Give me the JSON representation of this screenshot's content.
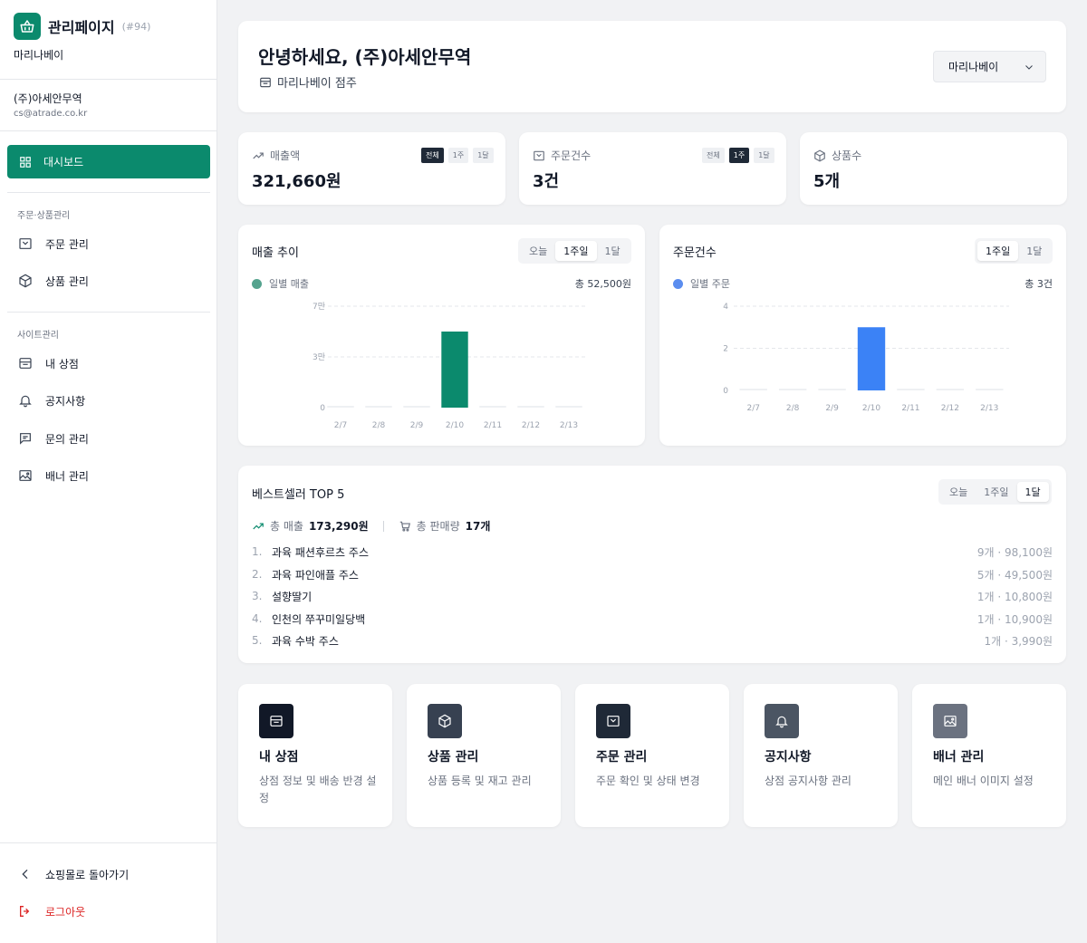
{
  "sidebar": {
    "brand_title": "관리페이지",
    "brand_id": "(#94)",
    "brand_sub": "마리나베이",
    "account_name": "(주)아세안무역",
    "account_email": "cs@atrade.co.kr",
    "dashboard_label": "대시보드",
    "section1": "주문·상품관리",
    "order_label": "주문 관리",
    "product_label": "상품 관리",
    "section2": "사이트관리",
    "store_label": "내 상점",
    "notice_label": "공지사항",
    "inquiry_label": "문의 관리",
    "banner_label": "배너 관리",
    "back_label": "쇼핑몰로 돌아가기",
    "logout_label": "로그아웃"
  },
  "header": {
    "greeting": "안녕하세요, (주)아세안무역",
    "store_owner": "마리나베이 점주",
    "store_select": "마리나베이"
  },
  "stats": {
    "sales": {
      "label": "매출액",
      "value": "321,660원",
      "periods": [
        "전체",
        "1주",
        "1달"
      ],
      "active": 0
    },
    "orders": {
      "label": "주문건수",
      "value": "3건",
      "periods": [
        "전체",
        "1주",
        "1달"
      ],
      "active": 1
    },
    "products": {
      "label": "상품수",
      "value": "5개"
    }
  },
  "sales_chart": {
    "title": "매출 추이",
    "tabs": [
      "오늘",
      "1주일",
      "1달"
    ],
    "active_tab": 1,
    "legend": "일별 매출",
    "total": "총 52,500원"
  },
  "orders_chart": {
    "title": "주문건수",
    "tabs": [
      "1주일",
      "1달"
    ],
    "active_tab": 0,
    "legend": "일별 주문",
    "total": "총 3건"
  },
  "chart_data": [
    {
      "type": "bar",
      "title": "매출 추이",
      "categories": [
        "2/7",
        "2/8",
        "2/9",
        "2/10",
        "2/11",
        "2/12",
        "2/13"
      ],
      "series": [
        {
          "name": "일별 매출",
          "values": [
            0,
            0,
            0,
            52500,
            0,
            0,
            0
          ]
        }
      ],
      "ylim": [
        0,
        70000
      ],
      "yticks": [
        {
          "v": 0,
          "label": "0"
        },
        {
          "v": 35000,
          "label": "3만"
        },
        {
          "v": 70000,
          "label": "7만"
        }
      ],
      "grid": true,
      "color": "#0b8a6d"
    },
    {
      "type": "bar",
      "title": "주문건수",
      "categories": [
        "2/7",
        "2/8",
        "2/9",
        "2/10",
        "2/11",
        "2/12",
        "2/13"
      ],
      "series": [
        {
          "name": "일별 주문",
          "values": [
            0,
            0,
            0,
            3,
            0,
            0,
            0
          ]
        }
      ],
      "ylim": [
        0,
        4
      ],
      "yticks": [
        {
          "v": 0,
          "label": "0"
        },
        {
          "v": 2,
          "label": "2"
        },
        {
          "v": 4,
          "label": "4"
        }
      ],
      "grid": true,
      "color": "#3b82f6"
    }
  ],
  "bestsellers": {
    "title": "베스트셀러 TOP 5",
    "tabs": [
      "오늘",
      "1주일",
      "1달"
    ],
    "active_tab": 2,
    "total_sales_label": "총 매출",
    "total_sales_value": "173,290원",
    "total_qty_label": "총 판매량",
    "total_qty_value": "17개",
    "items": [
      {
        "rank": "1.",
        "name": "과육 패션후르츠 주스",
        "meta": "9개 · 98,100원"
      },
      {
        "rank": "2.",
        "name": "과육 파인애플 주스",
        "meta": "5개 · 49,500원"
      },
      {
        "rank": "3.",
        "name": "설향딸기",
        "meta": "1개 · 10,800원"
      },
      {
        "rank": "4.",
        "name": "인천의 쭈꾸미일당백",
        "meta": "1개 · 10,900원"
      },
      {
        "rank": "5.",
        "name": "과육 수박 주스",
        "meta": "1개 · 3,990원"
      }
    ]
  },
  "quick_links": [
    {
      "title": "내 상점",
      "desc": "상점 정보 및 배송 반경 설정",
      "icon": "store-icon",
      "color": "#111827"
    },
    {
      "title": "상품 관리",
      "desc": "상품 등록 및 재고 관리",
      "icon": "box-icon",
      "color": "#374151"
    },
    {
      "title": "주문 관리",
      "desc": "주문 확인 및 상태 변경",
      "icon": "order-icon",
      "color": "#1f2937"
    },
    {
      "title": "공지사항",
      "desc": "상점 공지사항 관리",
      "icon": "bell-icon",
      "color": "#4b5563"
    },
    {
      "title": "배너 관리",
      "desc": "메인 배너 이미지 설정",
      "icon": "image-icon",
      "color": "#6b7280"
    }
  ]
}
